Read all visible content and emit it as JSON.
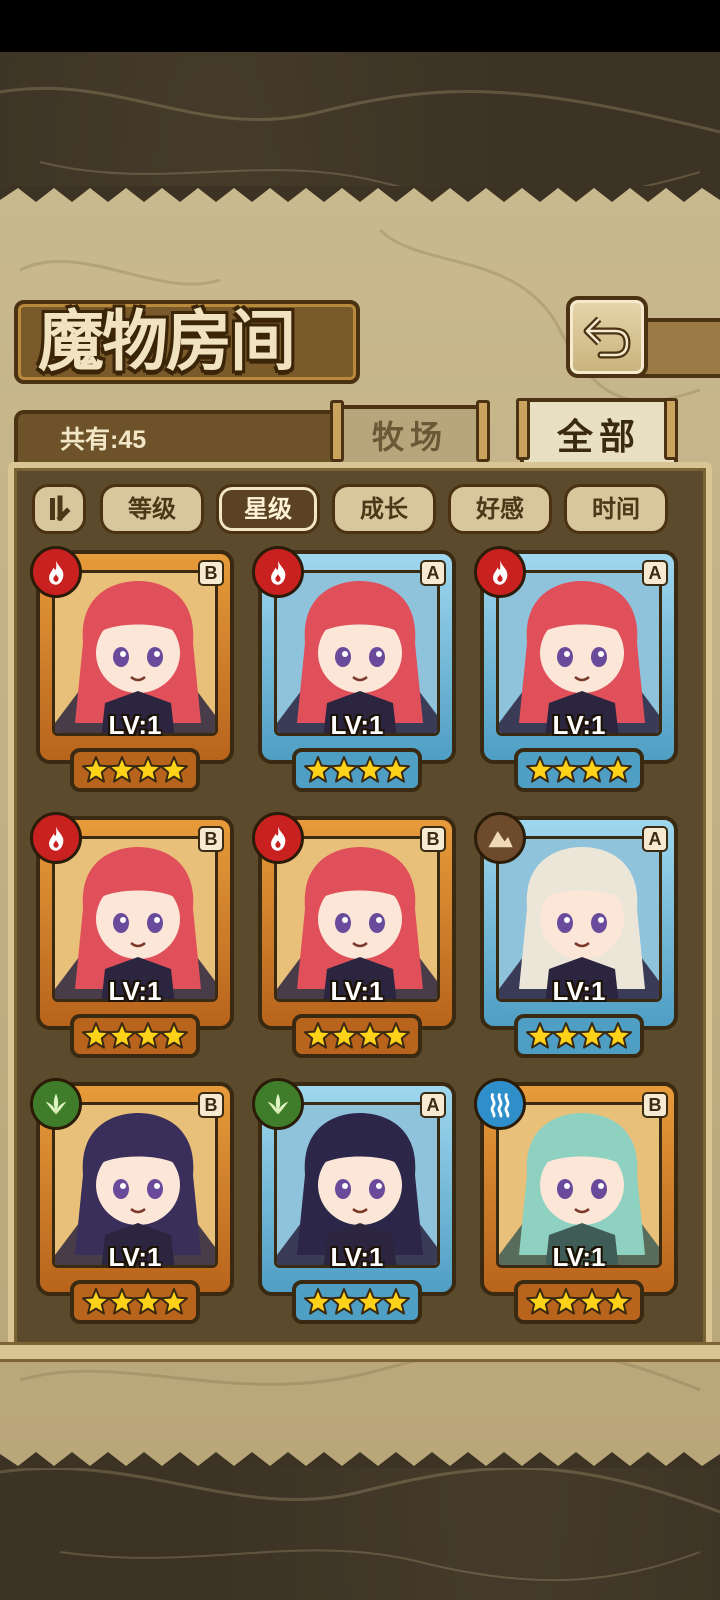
{
  "title": "魔物房间",
  "count_label": "共有:45",
  "tabs": [
    {
      "label": "牧场"
    },
    {
      "label": "全部"
    }
  ],
  "sort_buttons": [
    {
      "label": "等级"
    },
    {
      "label": "星级"
    },
    {
      "label": "成长"
    },
    {
      "label": "好感"
    },
    {
      "label": "时间"
    }
  ],
  "active_sort": "星级",
  "cards": [
    {
      "element": "fire",
      "grade": "B",
      "level": "LV:1",
      "stars": 4,
      "hair": "#e0505a"
    },
    {
      "element": "fire",
      "grade": "A",
      "level": "LV:1",
      "stars": 4,
      "hair": "#e0505a"
    },
    {
      "element": "fire",
      "grade": "A",
      "level": "LV:1",
      "stars": 4,
      "hair": "#e0505a"
    },
    {
      "element": "fire",
      "grade": "B",
      "level": "LV:1",
      "stars": 4,
      "hair": "#e0505a"
    },
    {
      "element": "fire",
      "grade": "B",
      "level": "LV:1",
      "stars": 4,
      "hair": "#e0505a"
    },
    {
      "element": "earth",
      "grade": "A",
      "level": "LV:1",
      "stars": 4,
      "hair": "#ece6d8"
    },
    {
      "element": "wood",
      "grade": "B",
      "level": "LV:1",
      "stars": 4,
      "hair": "#3a2e5a"
    },
    {
      "element": "wood",
      "grade": "A",
      "level": "LV:1",
      "stars": 4,
      "hair": "#2c2748"
    },
    {
      "element": "water",
      "grade": "B",
      "level": "LV:1",
      "stars": 4,
      "hair": "#8fd1c0"
    }
  ],
  "colors": {
    "fire": "#c92020",
    "earth": "#6e4a2c",
    "wood": "#3f7d2a",
    "water": "#2f8fca",
    "frame_b": "#e79b3a",
    "frame_a": "#9fd7ee",
    "star": "#ffd21a"
  }
}
